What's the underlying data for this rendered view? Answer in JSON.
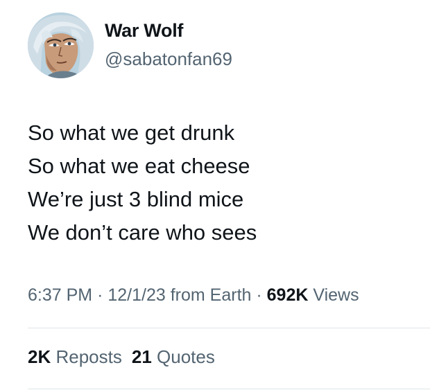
{
  "author": {
    "display_name": "War Wolf",
    "handle": "@sabatonfan69",
    "avatar_icon": "anime-portrait-avatar"
  },
  "tweet": {
    "lines": [
      "So what we get drunk",
      "So what we eat cheese",
      "We’re just 3 blind mice",
      "We don’t care who sees"
    ]
  },
  "meta": {
    "time": "6:37 PM",
    "separator": "·",
    "date": "12/1/23",
    "source": "from Earth",
    "views_count": "692K",
    "views_label": "Views"
  },
  "stats": {
    "reposts_count": "2K",
    "reposts_label": "Reposts",
    "quotes_count": "21",
    "quotes_label": "Quotes"
  },
  "colors": {
    "text_primary": "#0f1419",
    "text_secondary": "#536471",
    "divider": "#dfe4e8"
  }
}
